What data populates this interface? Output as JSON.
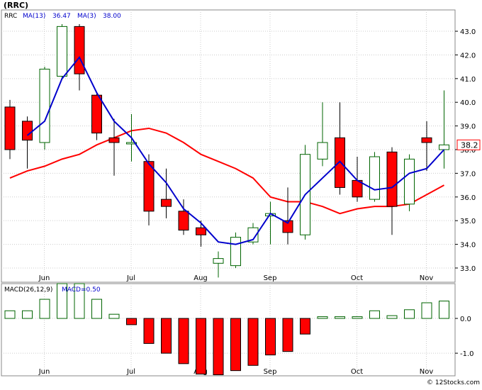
{
  "header": {
    "ticker_title": "(RRC)",
    "price_panel_label": "RRC",
    "ma13_label": "MA(13)",
    "ma13_value": "36.47",
    "ma3_label": "MA(3)",
    "ma3_value": "38.00",
    "macd_label": "MACD(26,12,9)",
    "macd_value_label": "MACD=0.50",
    "watermark": "© 12Stocks.com",
    "current_price_label": "38.2"
  },
  "colors": {
    "up_candle_border": "#006400",
    "down_candle_fill": "#ff0000",
    "ma13_line": "#ff0000",
    "ma3_line": "#0000cc",
    "macd_negative": "#ff0000",
    "macd_positive_border": "#006400",
    "label_blue": "#0000cc",
    "price_box": "#ff0000",
    "grid": "#cccccc"
  },
  "chart_data": [
    {
      "type": "candlestick",
      "title": "(RRC)",
      "ylim": [
        32.4,
        43.9
      ],
      "y_ticks": [
        33.0,
        34.0,
        35.0,
        36.0,
        37.0,
        38.0,
        39.0,
        40.0,
        41.0,
        42.0,
        43.0
      ],
      "y_tick_labels": [
        "33.0",
        "34.0",
        "35.0",
        "36.0",
        "37.0",
        "38.0",
        "39.0",
        "40.0",
        "41.0",
        "42.0",
        "43.0"
      ],
      "x_month_labels": [
        {
          "label": "Jun",
          "index": 1
        },
        {
          "label": "Jul",
          "index": 6
        },
        {
          "label": "Aug",
          "index": 10
        },
        {
          "label": "Sep",
          "index": 14
        },
        {
          "label": "Oct",
          "index": 19
        },
        {
          "label": "Nov",
          "index": 23
        }
      ],
      "candles": [
        {
          "open": 39.8,
          "high": 40.1,
          "low": 37.6,
          "close": 38.0
        },
        {
          "open": 39.2,
          "high": 39.4,
          "low": 37.2,
          "close": 38.4
        },
        {
          "open": 38.3,
          "high": 41.5,
          "low": 38.0,
          "close": 41.4
        },
        {
          "open": 41.1,
          "high": 43.3,
          "low": 41.0,
          "close": 43.2
        },
        {
          "open": 43.2,
          "high": 43.3,
          "low": 40.5,
          "close": 41.2
        },
        {
          "open": 40.3,
          "high": 40.4,
          "low": 38.4,
          "close": 38.7
        },
        {
          "open": 38.5,
          "high": 39.3,
          "low": 36.9,
          "close": 38.3
        },
        {
          "open": 38.3,
          "high": 39.5,
          "low": 37.5,
          "close": 38.3
        },
        {
          "open": 37.5,
          "high": 37.8,
          "low": 34.8,
          "close": 35.4
        },
        {
          "open": 35.9,
          "high": 37.2,
          "low": 35.1,
          "close": 35.6
        },
        {
          "open": 35.4,
          "high": 35.9,
          "low": 34.4,
          "close": 34.6
        },
        {
          "open": 34.7,
          "high": 35.0,
          "low": 33.9,
          "close": 34.4
        },
        {
          "open": 33.2,
          "high": 33.7,
          "low": 32.6,
          "close": 33.4
        },
        {
          "open": 33.1,
          "high": 34.5,
          "low": 33.0,
          "close": 34.3
        },
        {
          "open": 34.1,
          "high": 34.9,
          "low": 34.0,
          "close": 34.7
        },
        {
          "open": 35.2,
          "high": 35.8,
          "low": 34.0,
          "close": 35.3
        },
        {
          "open": 35.0,
          "high": 36.4,
          "low": 34.0,
          "close": 34.5
        },
        {
          "open": 34.4,
          "high": 38.2,
          "low": 34.2,
          "close": 37.8
        },
        {
          "open": 37.6,
          "high": 40.0,
          "low": 37.3,
          "close": 38.3
        },
        {
          "open": 38.5,
          "high": 40.0,
          "low": 36.1,
          "close": 36.4
        },
        {
          "open": 36.7,
          "high": 37.7,
          "low": 35.8,
          "close": 36.0
        },
        {
          "open": 35.9,
          "high": 37.9,
          "low": 35.8,
          "close": 37.7
        },
        {
          "open": 37.9,
          "high": 38.1,
          "low": 34.4,
          "close": 35.6
        },
        {
          "open": 35.7,
          "high": 37.8,
          "low": 35.4,
          "close": 37.6
        },
        {
          "open": 38.5,
          "high": 39.2,
          "low": 37.1,
          "close": 38.3
        },
        {
          "open": 38.0,
          "high": 40.5,
          "low": 37.2,
          "close": 38.2
        }
      ],
      "series": [
        {
          "name": "MA(13)",
          "points": [
            [
              0,
              36.8
            ],
            [
              1,
              37.1
            ],
            [
              2,
              37.3
            ],
            [
              3,
              37.6
            ],
            [
              4,
              37.8
            ],
            [
              5,
              38.2
            ],
            [
              6,
              38.5
            ],
            [
              7,
              38.8
            ],
            [
              8,
              38.9
            ],
            [
              9,
              38.7
            ],
            [
              10,
              38.3
            ],
            [
              11,
              37.8
            ],
            [
              12,
              37.5
            ],
            [
              13,
              37.2
            ],
            [
              14,
              36.8
            ],
            [
              15,
              36.0
            ],
            [
              16,
              35.8
            ],
            [
              17,
              35.8
            ],
            [
              18,
              35.6
            ],
            [
              19,
              35.3
            ],
            [
              20,
              35.5
            ],
            [
              21,
              35.6
            ],
            [
              22,
              35.6
            ],
            [
              23,
              35.7
            ],
            [
              24,
              36.1
            ],
            [
              25,
              36.5
            ]
          ]
        },
        {
          "name": "MA(3)",
          "points": [
            [
              1,
              38.6
            ],
            [
              2,
              39.2
            ],
            [
              3,
              41.0
            ],
            [
              4,
              41.9
            ],
            [
              5,
              40.4
            ],
            [
              6,
              39.2
            ],
            [
              7,
              38.5
            ],
            [
              8,
              37.4
            ],
            [
              9,
              36.6
            ],
            [
              10,
              35.5
            ],
            [
              11,
              34.9
            ],
            [
              12,
              34.1
            ],
            [
              13,
              34.0
            ],
            [
              14,
              34.2
            ],
            [
              15,
              35.3
            ],
            [
              16,
              34.9
            ],
            [
              17,
              36.1
            ],
            [
              18,
              36.8
            ],
            [
              19,
              37.5
            ],
            [
              20,
              36.7
            ],
            [
              21,
              36.3
            ],
            [
              22,
              36.4
            ],
            [
              23,
              37.0
            ],
            [
              24,
              37.2
            ],
            [
              25,
              38.0
            ]
          ]
        }
      ],
      "current_price": 38.2
    },
    {
      "type": "bar",
      "title": "MACD(26,12,9)",
      "ylim": [
        -1.65,
        1.0
      ],
      "y_ticks": [
        0.0,
        -1.0
      ],
      "y_tick_labels": [
        "0.0",
        "-1.0"
      ],
      "values": [
        0.22,
        0.22,
        0.55,
        1.0,
        1.0,
        0.55,
        0.12,
        -0.18,
        -0.72,
        -1.0,
        -1.3,
        -1.6,
        -1.62,
        -1.5,
        -1.35,
        -1.05,
        -0.95,
        -0.45,
        0.05,
        0.05,
        0.05,
        0.22,
        0.08,
        0.25,
        0.45,
        0.5
      ]
    }
  ]
}
